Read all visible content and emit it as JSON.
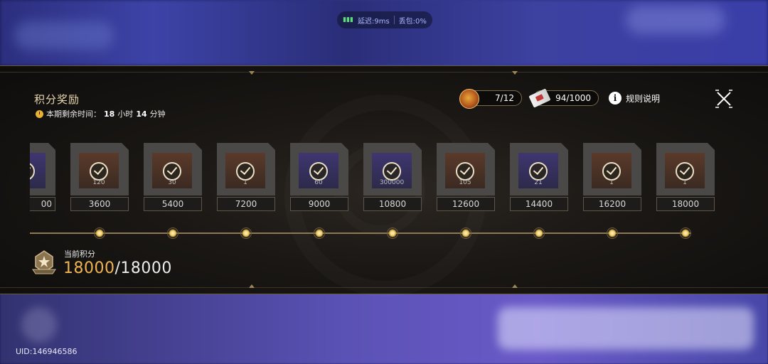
{
  "status_bar": {
    "latency": "延迟:9ms",
    "packet_loss": "丢包:0%"
  },
  "uid": "UID:146946586",
  "panel": {
    "title": "积分奖励",
    "timer": {
      "prefix": "本期剩余时间：",
      "hours": "18",
      "hours_unit": "小时",
      "minutes": "14",
      "minutes_unit": "分钟"
    },
    "resources": [
      {
        "icon": "medal-icon",
        "value": "7/12"
      },
      {
        "icon": "ticket-icon",
        "value": "94/1000"
      }
    ],
    "rules_label": "规则说明",
    "rewards": [
      {
        "points": "00",
        "quantity": "",
        "style": "purple"
      },
      {
        "points": "3600",
        "quantity": "120",
        "style": "brown"
      },
      {
        "points": "5400",
        "quantity": "30",
        "style": "brown"
      },
      {
        "points": "7200",
        "quantity": "1",
        "style": "brown"
      },
      {
        "points": "9000",
        "quantity": "60",
        "style": "purple"
      },
      {
        "points": "10800",
        "quantity": "300000",
        "style": "purple"
      },
      {
        "points": "12600",
        "quantity": "105",
        "style": "brown"
      },
      {
        "points": "14400",
        "quantity": "21",
        "style": "purple"
      },
      {
        "points": "16200",
        "quantity": "1",
        "style": "brown"
      },
      {
        "points": "18000",
        "quantity": "1",
        "style": "brown"
      }
    ],
    "current_points": {
      "label": "当前积分",
      "value": "18000",
      "max": "/18000"
    }
  },
  "colors": {
    "accent_gold": "#f0b451",
    "title_gold": "#e9d9b0",
    "track_line": "#8c7a55"
  }
}
